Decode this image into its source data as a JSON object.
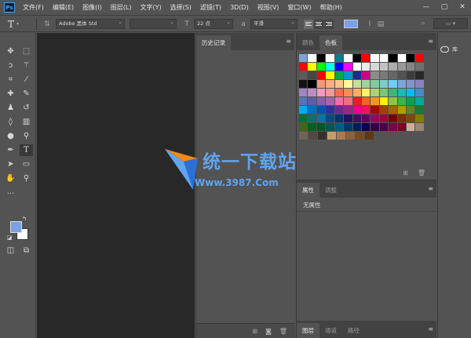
{
  "app": {
    "logo": "Ps"
  },
  "menu": [
    "文件(F)",
    "编辑(E)",
    "图像(I)",
    "图层(L)",
    "文字(Y)",
    "选择(S)",
    "滤镜(T)",
    "3D(D)",
    "视图(V)",
    "窗口(W)",
    "帮助(H)"
  ],
  "window_controls": {
    "minimize": "—",
    "maximize": "▢",
    "close": "✕"
  },
  "options": {
    "tool_glyph": "T",
    "font_family": "Adobe 黑体 Std",
    "font_style": "",
    "font_size": "22 点",
    "anti_alias": "平滑",
    "text_color": "#7aa1e6"
  },
  "history_panel": {
    "tab": "历史记录"
  },
  "swatches_panel": {
    "tabs": [
      "颜色",
      "色板"
    ],
    "active_tab": "色板"
  },
  "properties_panel": {
    "tabs": [
      "属性",
      "调整"
    ],
    "content": "无属性"
  },
  "layers_panel": {
    "tabs": [
      "图层",
      "通道",
      "路径"
    ]
  },
  "dock": {
    "library_label": "库"
  },
  "colors": {
    "foreground": "#7aa1e6",
    "background": "#ffffff"
  },
  "watermark": {
    "title": "统一下载站",
    "url": "Www.3987.Com"
  },
  "swatch_rows": [
    [
      "#7ea3d6",
      "#ffffff",
      "#000000",
      "#ffffff",
      "#0c7d8c",
      "#ffffff",
      "#000000",
      "#ff0000",
      "#ffffff",
      "#ffffff",
      "#000000",
      "#ffffff",
      "#000000",
      "#ff0000"
    ],
    [
      "#ff0000",
      "#ffff00",
      "#00ff00",
      "#00ffff",
      "#0000ff",
      "#ff00ff",
      "#ffffff",
      "#ebebeb",
      "#d6d6d6",
      "#c2c2c2",
      "#adadad",
      "#999999",
      "#858585",
      "#707070"
    ],
    [
      "#5c5c5c",
      "#474747",
      "#ff0000",
      "#ffff00",
      "#00aa44",
      "#0099cc",
      "#1f2a8c",
      "#cc0088",
      "#8c8c8c",
      "#7a7a7a",
      "#666666",
      "#525252",
      "#3d3d3d",
      "#292929"
    ],
    [
      "#141414",
      "#000000",
      "#f7977a",
      "#f9ad81",
      "#fdc68a",
      "#fff79a",
      "#c4df9b",
      "#a3d39c",
      "#82ca9d",
      "#7bcdc8",
      "#6ecff6",
      "#7ea7d8",
      "#8493ca",
      "#8882be"
    ],
    [
      "#a187be",
      "#bc8dbf",
      "#f49ac2",
      "#f6989d",
      "#f26c4f",
      "#f68e55",
      "#fbaf5c",
      "#fff467",
      "#acd372",
      "#7cc576",
      "#3bb878",
      "#1abbb4",
      "#00bff3",
      "#438ccb"
    ],
    [
      "#5574b9",
      "#605ca8",
      "#855fa8",
      "#a763a8",
      "#f06ea9",
      "#f26d7d",
      "#ed1c24",
      "#f26522",
      "#f7941d",
      "#fff200",
      "#8dc63f",
      "#39b54a",
      "#00a651",
      "#00a99d"
    ],
    [
      "#00aeef",
      "#0072bc",
      "#0054a6",
      "#2e3192",
      "#662d91",
      "#92278f",
      "#ec008c",
      "#ed145b",
      "#9e0b0f",
      "#a0410d",
      "#a36209",
      "#aba000",
      "#598527",
      "#197b30"
    ],
    [
      "#007236",
      "#00746b",
      "#0076a3",
      "#004b80",
      "#003471",
      "#1b1464",
      "#440e62",
      "#630460",
      "#9e005d",
      "#9e0039",
      "#790000",
      "#7b2e00",
      "#7d4900",
      "#827b00"
    ],
    [
      "#406618",
      "#005e20",
      "#005826",
      "#005952",
      "#005b7f",
      "#003663",
      "#002157",
      "#0d004c",
      "#32004b",
      "#4b0049",
      "#7b0046",
      "#7a0026",
      "#c7b299",
      "#998675"
    ],
    [
      "#736357",
      "#534741",
      "#37302d",
      "#c69c6d",
      "#a67c52",
      "#8c6239",
      "#754c24",
      "#603913"
    ]
  ]
}
